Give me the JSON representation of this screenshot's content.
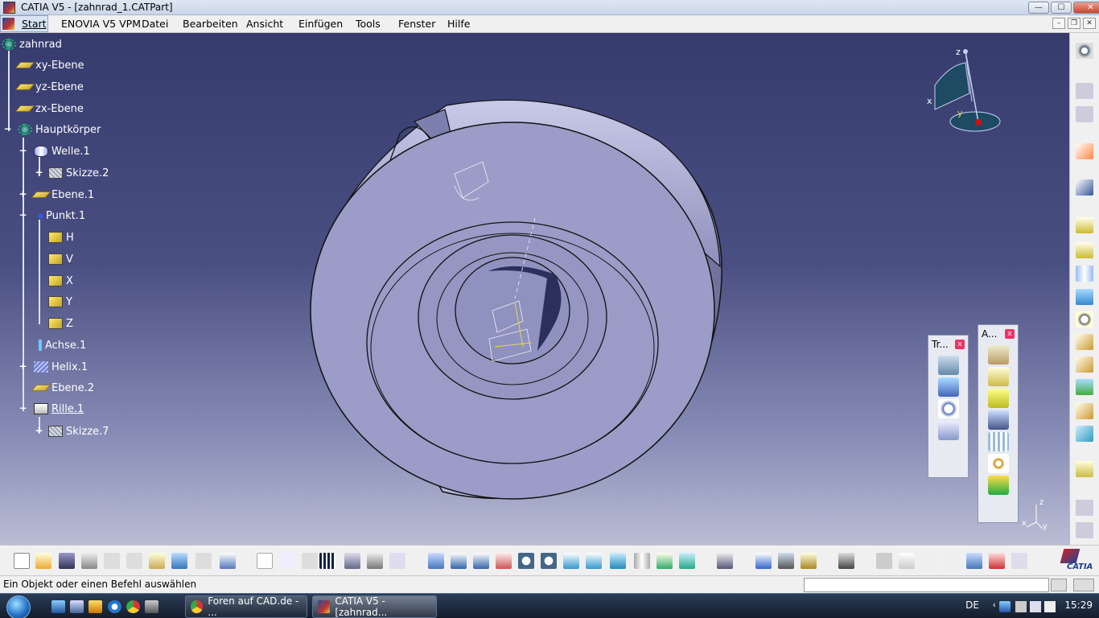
{
  "window": {
    "title": "CATIA V5 - [zahnrad_1.CATPart]",
    "buttons": {
      "minimize": "—",
      "maximize": "☐",
      "close": "✕"
    }
  },
  "menu": {
    "items": [
      "Start",
      "ENOVIA V5 VPM",
      "Datei",
      "Bearbeiten",
      "Ansicht",
      "Einfügen",
      "Tools",
      "Fenster",
      "Hilfe"
    ]
  },
  "tree": {
    "root": "zahnrad",
    "nodes": [
      {
        "label": "xy-Ebene",
        "icon": "plane-icon"
      },
      {
        "label": "yz-Ebene",
        "icon": "plane-icon"
      },
      {
        "label": "zx-Ebene",
        "icon": "plane-icon"
      },
      {
        "label": "Hauptkörper",
        "icon": "body-gear-icon"
      },
      {
        "label": "Welle.1",
        "icon": "shaft-icon"
      },
      {
        "label": "Skizze.2",
        "icon": "sketch-icon"
      },
      {
        "label": "Ebene.1",
        "icon": "plane-icon"
      },
      {
        "label": "Punkt.1",
        "icon": "point-icon"
      },
      {
        "label": "H",
        "icon": "parameter-cube-icon"
      },
      {
        "label": "V",
        "icon": "parameter-cube-icon"
      },
      {
        "label": "X",
        "icon": "parameter-cube-icon"
      },
      {
        "label": "Y",
        "icon": "parameter-cube-icon"
      },
      {
        "label": "Z",
        "icon": "parameter-cube-icon"
      },
      {
        "label": "Achse.1",
        "icon": "axis-icon"
      },
      {
        "label": "Helix.1",
        "icon": "helix-icon"
      },
      {
        "label": "Ebene.2",
        "icon": "plane-icon"
      },
      {
        "label": "Rille.1",
        "icon": "groove-icon"
      },
      {
        "label": "Skizze.7",
        "icon": "sketch-icon"
      }
    ]
  },
  "compass": {
    "x": "x",
    "y": "y",
    "z": "z"
  },
  "toolbars": {
    "transform": {
      "title": "Tr...",
      "close": "x"
    },
    "analysis": {
      "title": "A...",
      "close": "x"
    }
  },
  "statusbar": {
    "message": "Ein Objekt oder einen Befehl auswählen",
    "command_value": ""
  },
  "axis_indicator": {
    "x": "x",
    "y": "y",
    "z": "z"
  },
  "taskbar": {
    "buttons": [
      {
        "label": "Foren auf CAD.de - ...",
        "icon": "chrome-icon"
      },
      {
        "label": "CATIA V5 - [zahnrad...",
        "icon": "catia-icon"
      }
    ],
    "language": "DE",
    "time": "15:29"
  },
  "brand": {
    "logo_text": "CATIA"
  },
  "colors": {
    "viewport_top": "#363b6e",
    "viewport_bottom": "#b9bdd4",
    "part_fill": "#9a9cc6",
    "tree_text": "#ffffff"
  }
}
